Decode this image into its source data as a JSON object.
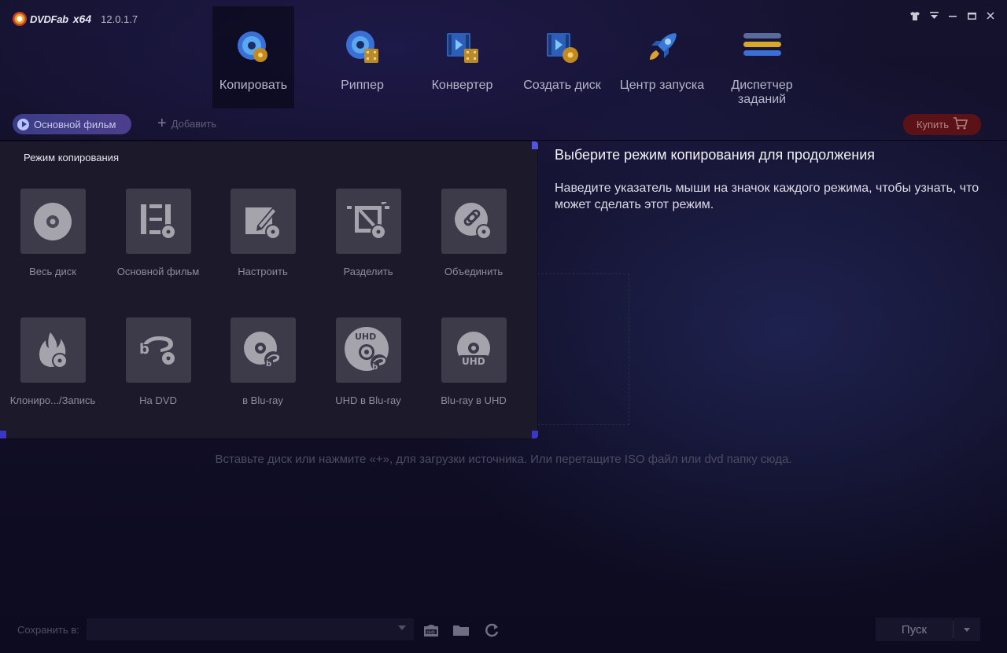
{
  "app": {
    "logo_text": "DVDFab",
    "arch": "x64",
    "version": "12.0.1.7"
  },
  "window_controls": [
    "shirt-icon",
    "menu-icon",
    "minimize-icon",
    "maximize-icon",
    "close-icon"
  ],
  "nav": [
    {
      "label": "Копировать",
      "icon": "disc-copy-icon",
      "active": true
    },
    {
      "label": "Риппер",
      "icon": "disc-ripper-icon"
    },
    {
      "label": "Конвертер",
      "icon": "video-converter-icon"
    },
    {
      "label": "Создать диск",
      "icon": "disc-creator-icon"
    },
    {
      "label": "Центр запуска",
      "icon": "rocket-icon"
    },
    {
      "label": "Диспетчер заданий",
      "icon": "task-list-icon"
    }
  ],
  "toolbar": {
    "mode_pill": "Основной фильм",
    "add_label": "Добавить",
    "buy_label": "Купить"
  },
  "mode_panel": {
    "title": "Режим копирования",
    "modes": [
      {
        "label": "Весь диск",
        "icon": "full-disc-icon"
      },
      {
        "label": "Основной фильм",
        "icon": "main-movie-icon"
      },
      {
        "label": "Настроить",
        "icon": "customize-icon"
      },
      {
        "label": "Разделить",
        "icon": "split-icon"
      },
      {
        "label": "Объединить",
        "icon": "merge-icon"
      },
      {
        "label": "Клониро.../Запись",
        "icon": "clone-burn-icon"
      },
      {
        "label": "На DVD",
        "icon": "to-dvd-icon"
      },
      {
        "label": "в Blu-ray",
        "icon": "to-bluray-icon"
      },
      {
        "label": "UHD в Blu-ray",
        "icon": "uhd-to-bluray-icon"
      },
      {
        "label": "Blu-ray в UHD",
        "icon": "bluray-to-uhd-icon"
      }
    ]
  },
  "info": {
    "title": "Выберите режим копирования для продолжения",
    "text": "Наведите указатель мыши на значок каждого режима, чтобы узнать, что может сделать этот режим."
  },
  "drop_hint": "Вставьте диск или нажмите «+», для загрузки источника. Или перетащите ISO файл или dvd папку сюда.",
  "bottom": {
    "save_label": "Сохранить в:",
    "save_value": "",
    "start_label": "Пуск"
  },
  "colors": {
    "accent": "#4a4cb8",
    "buy": "#5a1216",
    "tile": "#3d3b4a"
  }
}
